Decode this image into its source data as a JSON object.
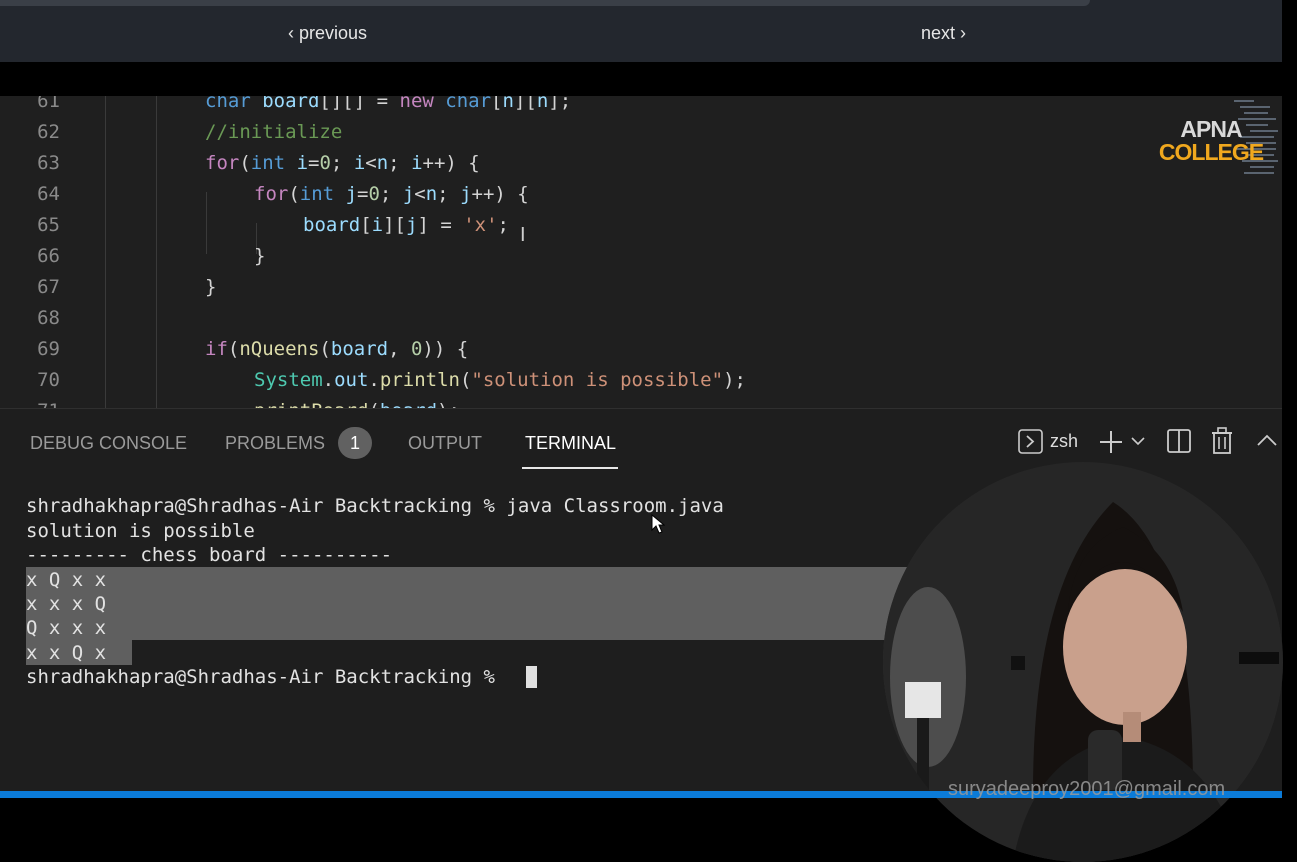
{
  "nav": {
    "previous": "previous",
    "next": "next",
    "prev_chevron": "‹",
    "next_chevron": "›"
  },
  "editor": {
    "lines": [
      {
        "n": "61"
      },
      {
        "n": "62"
      },
      {
        "n": "63"
      },
      {
        "n": "64"
      },
      {
        "n": "65"
      },
      {
        "n": "66"
      },
      {
        "n": "67"
      },
      {
        "n": "68"
      },
      {
        "n": "69"
      },
      {
        "n": "70"
      },
      {
        "n": "71"
      }
    ]
  },
  "watermark": {
    "line1": "APNA",
    "line2": "COLLEGE"
  },
  "panel": {
    "tabs": {
      "debug": "DEBUG CONSOLE",
      "problems": "PROBLEMS",
      "output": "OUTPUT",
      "terminal": "TERMINAL"
    },
    "problems_count": "1",
    "shell": "zsh"
  },
  "terminal": {
    "cmd": "shradhakhapra@Shradhas-Air Backtracking % java Classroom.java",
    "out1": "solution is possible",
    "out2": "--------- chess board ----------",
    "rows": [
      "x Q x x",
      "x x x Q",
      "Q x x x",
      "x x Q x"
    ],
    "prompt": "shradhakhapra@Shradhas-Air Backtracking % "
  },
  "overlay_email": "suryadeeproy2001@gmail.com",
  "colors": {
    "accent": "#0b7bd8",
    "logo_orange": "#f0a81e"
  }
}
